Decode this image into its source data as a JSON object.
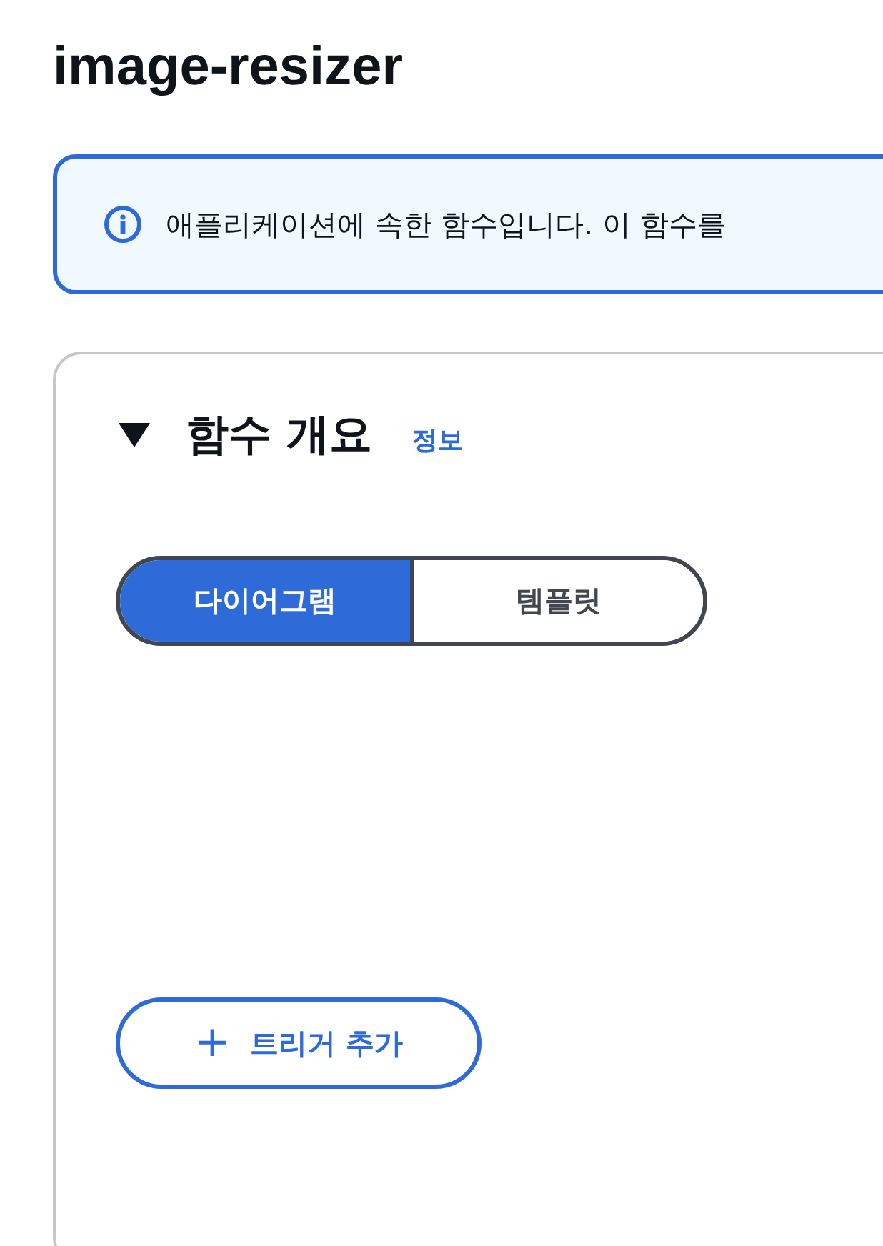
{
  "page": {
    "title": "image-resizer"
  },
  "alert": {
    "kind": "info",
    "message": "애플리케이션에 속한 함수입니다. 이 함수를"
  },
  "section": {
    "title": "함수 개요",
    "expanded": true,
    "info_link": "정보",
    "view_toggle": [
      {
        "label": "다이어그램",
        "selected": true
      },
      {
        "label": "템플릿",
        "selected": false
      }
    ],
    "add_trigger_button": {
      "icon": "+",
      "label": "트리거 추가"
    }
  }
}
